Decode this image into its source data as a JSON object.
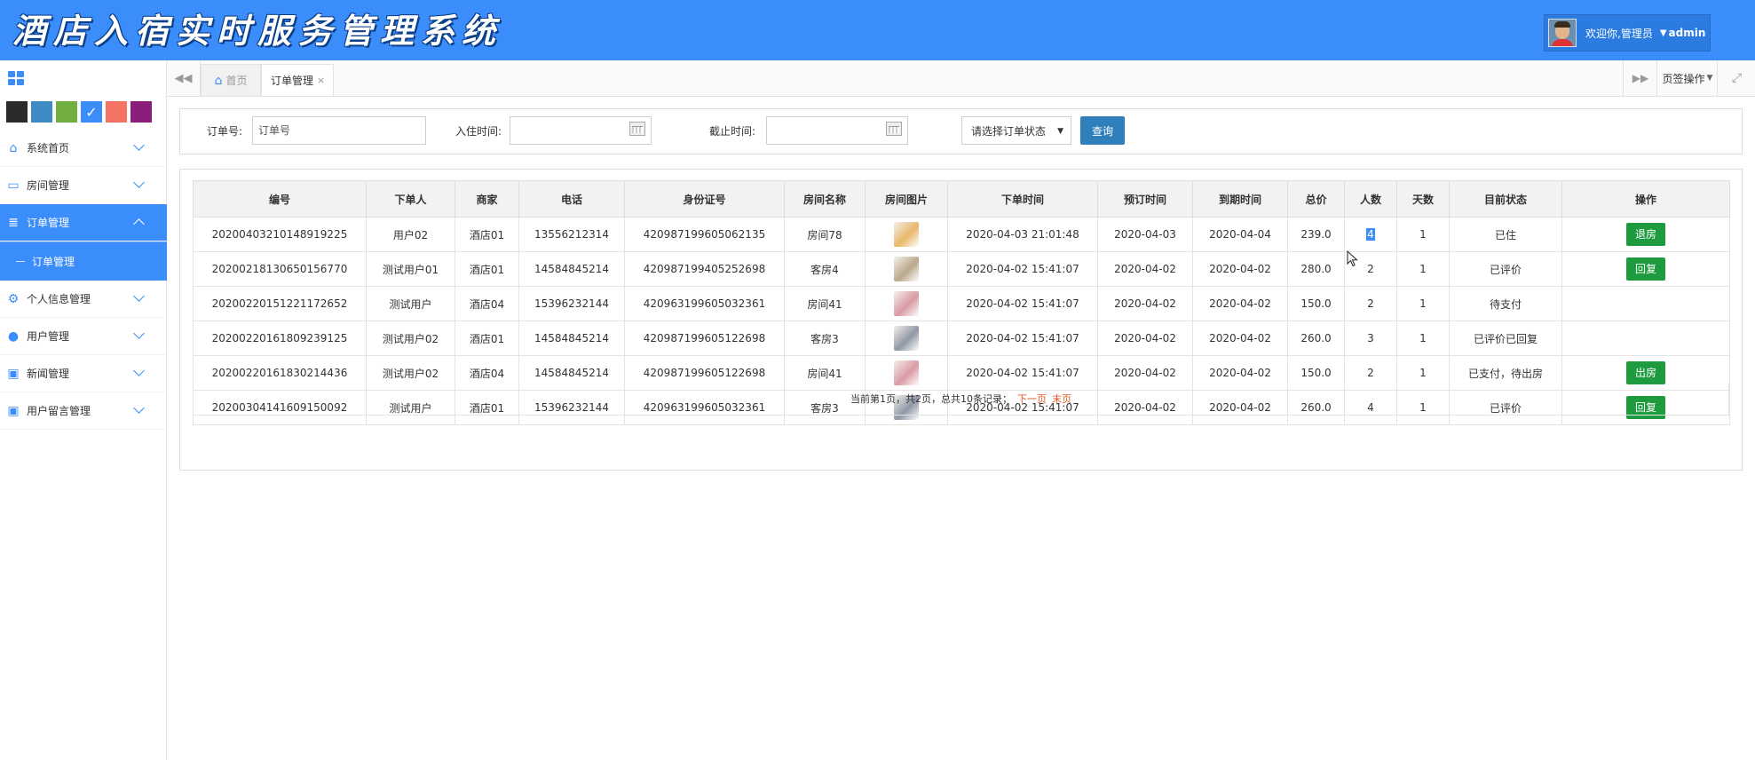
{
  "header": {
    "title": "酒店入宿实时服务管理系统",
    "welcome": "欢迎你,管理员",
    "username": "admin",
    "bg_color": "#3c8dfc"
  },
  "sidebar": {
    "theme_swatches": [
      "#2b2b2b",
      "#3e8ac4",
      "#6fae3f",
      "#3c8dfc",
      "#f47464",
      "#8a1e7a"
    ],
    "items": [
      {
        "label": "系统首页",
        "icon": "home-icon"
      },
      {
        "label": "房间管理",
        "icon": "monitor-icon"
      },
      {
        "label": "订单管理",
        "icon": "database-icon",
        "active": true
      },
      {
        "label": "个人信息管理",
        "icon": "gears-icon"
      },
      {
        "label": "用户管理",
        "icon": "user-icon"
      },
      {
        "label": "新闻管理",
        "icon": "image-icon"
      },
      {
        "label": "用户留言管理",
        "icon": "image-icon"
      }
    ],
    "subitem": "订单管理"
  },
  "tabs": {
    "home": "首页",
    "current": "订单管理",
    "close": "×",
    "page_ops": "页签操作"
  },
  "search": {
    "order_no_label": "订单号:",
    "order_no_placeholder": "订单号",
    "checkin_label": "入住时间:",
    "deadline_label": "截止时间:",
    "status_select": "请选择订单状态",
    "query_button": "查询"
  },
  "table": {
    "headers": [
      "编号",
      "下单人",
      "商家",
      "电话",
      "身份证号",
      "房间名称",
      "房间图片",
      "下单时间",
      "预订时间",
      "到期时间",
      "总价",
      "人数",
      "天数",
      "目前状态",
      "操作"
    ],
    "rows": [
      {
        "id": "20200403210148919225",
        "user": "用户02",
        "merchant": "酒店01",
        "phone": "13556212314",
        "idcard": "420987199605062135",
        "room": "房间78",
        "img_color": "#e8b86a",
        "order_time": "2020-04-03 21:01:48",
        "book_date": "2020-04-03",
        "expire_date": "2020-04-04",
        "price": "239.0",
        "people": "4",
        "days": "1",
        "status": "已住",
        "action": "退房"
      },
      {
        "id": "20200218130650156770",
        "user": "测试用户01",
        "merchant": "酒店01",
        "phone": "14584845214",
        "idcard": "420987199405252698",
        "room": "客房4",
        "img_color": "#b9a98a",
        "order_time": "2020-04-02 15:41:07",
        "book_date": "2020-04-02",
        "expire_date": "2020-04-02",
        "price": "280.0",
        "people": "2",
        "days": "1",
        "status": "已评价",
        "action": "回复"
      },
      {
        "id": "20200220151221172652",
        "user": "测试用户",
        "merchant": "酒店04",
        "phone": "15396232144",
        "idcard": "420963199605032361",
        "room": "房间41",
        "img_color": "#d99aa4",
        "order_time": "2020-04-02 15:41:07",
        "book_date": "2020-04-02",
        "expire_date": "2020-04-02",
        "price": "150.0",
        "people": "2",
        "days": "1",
        "status": "待支付",
        "action": ""
      },
      {
        "id": "20200220161809239125",
        "user": "测试用户02",
        "merchant": "酒店01",
        "phone": "14584845214",
        "idcard": "420987199605122698",
        "room": "客房3",
        "img_color": "#8f97a6",
        "order_time": "2020-04-02 15:41:07",
        "book_date": "2020-04-02",
        "expire_date": "2020-04-02",
        "price": "260.0",
        "people": "3",
        "days": "1",
        "status": "已评价已回复",
        "action": ""
      },
      {
        "id": "20200220161830214436",
        "user": "测试用户02",
        "merchant": "酒店04",
        "phone": "14584845214",
        "idcard": "420987199605122698",
        "room": "房间41",
        "img_color": "#d99aa4",
        "order_time": "2020-04-02 15:41:07",
        "book_date": "2020-04-02",
        "expire_date": "2020-04-02",
        "price": "150.0",
        "people": "2",
        "days": "1",
        "status": "已支付，待出房",
        "action": "出房"
      },
      {
        "id": "20200304141609150092",
        "user": "测试用户",
        "merchant": "酒店01",
        "phone": "15396232144",
        "idcard": "420963199605032361",
        "room": "客房3",
        "img_color": "#8f97a6",
        "order_time": "2020-04-02 15:41:07",
        "book_date": "2020-04-02",
        "expire_date": "2020-04-02",
        "price": "260.0",
        "people": "4",
        "days": "1",
        "status": "已评价",
        "action": "回复"
      }
    ],
    "action_color": "#1e9b3e"
  },
  "pager": {
    "info": "当前第1页，共2页，总共10条记录；",
    "next": "下一页",
    "last": "末页"
  }
}
